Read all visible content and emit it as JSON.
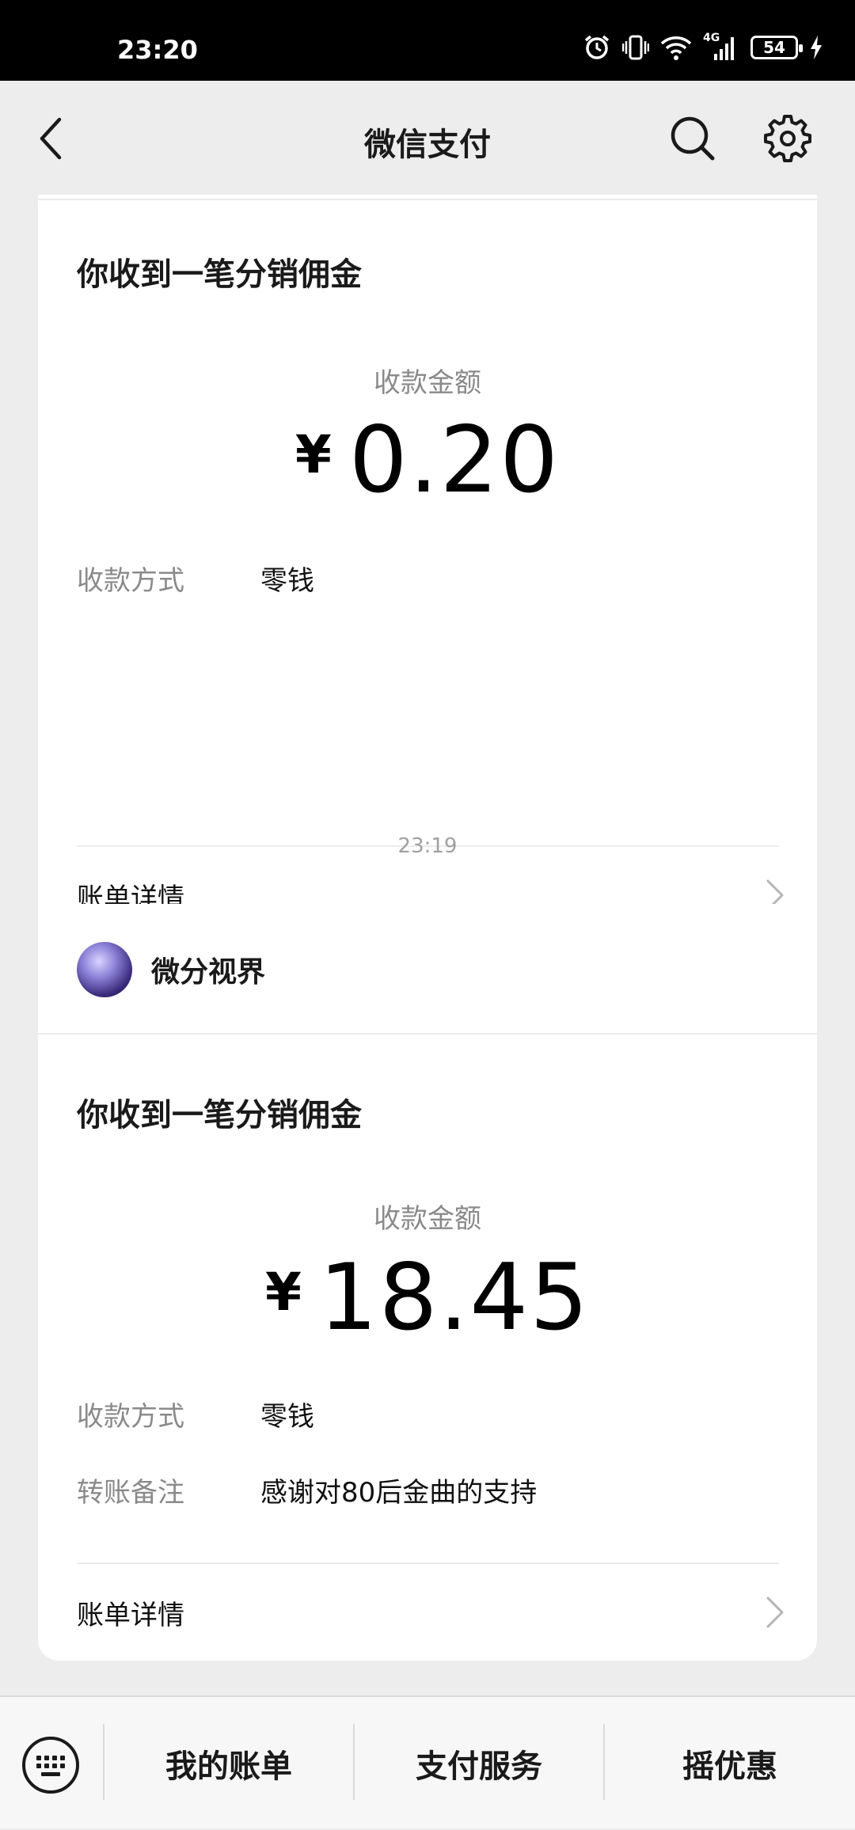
{
  "status_bar": {
    "time": "23:20",
    "battery": "54",
    "network": "4G"
  },
  "nav": {
    "title": "微信支付"
  },
  "card1": {
    "title": "你收到一笔分销佣金",
    "amount_label": "收款金额",
    "currency": "¥",
    "amount": "0.20",
    "method_label": "收款方式",
    "method_value": "零钱",
    "detail_label": "账单详情"
  },
  "timestamp": "23:19",
  "card2": {
    "merchant": "微分视界",
    "title": "你收到一笔分销佣金",
    "amount_label": "收款金额",
    "currency": "¥",
    "amount": "18.45",
    "method_label": "收款方式",
    "method_value": "零钱",
    "note_label": "转账备注",
    "note_value": "感谢对80后金曲的支持",
    "detail_label": "账单详情"
  },
  "bottom_menu": {
    "items": [
      "我的账单",
      "支付服务",
      "摇优惠"
    ]
  },
  "icons": {
    "back": "back-icon",
    "search": "search-icon",
    "settings": "gear-icon",
    "keyboard": "keyboard-icon",
    "chevron": "chevron-right-icon"
  }
}
